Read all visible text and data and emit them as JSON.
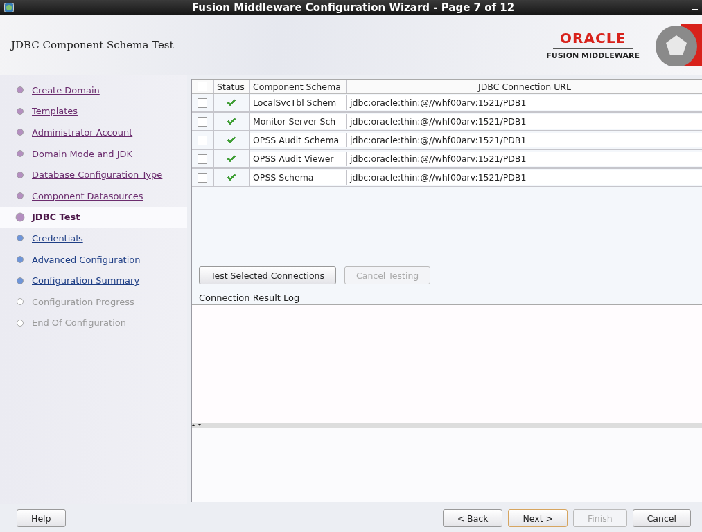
{
  "window": {
    "title": "Fusion Middleware Configuration Wizard - Page 7 of 12"
  },
  "header": {
    "title": "JDBC Component Schema Test",
    "logo": "ORACLE",
    "logo_subtitle": "FUSION MIDDLEWARE"
  },
  "steps": [
    {
      "label": "Create Domain",
      "kind": "done",
      "selected": false
    },
    {
      "label": "Templates",
      "kind": "done",
      "selected": false
    },
    {
      "label": "Administrator Account",
      "kind": "done",
      "selected": false
    },
    {
      "label": "Domain Mode and JDK",
      "kind": "done",
      "selected": false
    },
    {
      "label": "Database Configuration Type",
      "kind": "done",
      "selected": false
    },
    {
      "label": "Component Datasources",
      "kind": "done",
      "selected": false
    },
    {
      "label": "JDBC Test",
      "kind": "done",
      "selected": true
    },
    {
      "label": "Credentials",
      "kind": "next",
      "selected": false
    },
    {
      "label": "Advanced Configuration",
      "kind": "next",
      "selected": false
    },
    {
      "label": "Configuration Summary",
      "kind": "next",
      "selected": false
    },
    {
      "label": "Configuration Progress",
      "kind": "locked",
      "selected": false
    },
    {
      "label": "End Of Configuration",
      "kind": "locked",
      "selected": false
    }
  ],
  "table": {
    "all_checked": false,
    "columns": [
      "Status",
      "Component Schema",
      "JDBC Connection URL"
    ],
    "rows": [
      {
        "checked": false,
        "passed": true,
        "schema": "LocalSvcTbl Schem",
        "url": "jdbc:oracle:thin:@//whf00arv:1521/PDB1"
      },
      {
        "checked": false,
        "passed": true,
        "schema": "Monitor Server Sch",
        "url": "jdbc:oracle:thin:@//whf00arv:1521/PDB1"
      },
      {
        "checked": false,
        "passed": true,
        "schema": "OPSS Audit Schema",
        "url": "jdbc:oracle:thin:@//whf00arv:1521/PDB1"
      },
      {
        "checked": false,
        "passed": true,
        "schema": "OPSS Audit Viewer",
        "url": "jdbc:oracle:thin:@//whf00arv:1521/PDB1"
      },
      {
        "checked": false,
        "passed": true,
        "schema": "OPSS Schema",
        "url": "jdbc:oracle:thin:@//whf00arv:1521/PDB1"
      }
    ]
  },
  "actions": [
    {
      "label": "Test Selected Connections",
      "disabled": false
    },
    {
      "label": "Cancel Testing",
      "disabled": true
    }
  ],
  "log": {
    "label": "Connection Result Log"
  },
  "footer": {
    "help": "Help",
    "buttons": [
      {
        "label": "< Back",
        "disabled": false,
        "selected": false
      },
      {
        "label": "Next >",
        "disabled": false,
        "selected": true
      },
      {
        "label": "Finish",
        "disabled": true,
        "selected": false
      },
      {
        "label": "Cancel",
        "disabled": false,
        "selected": false
      }
    ]
  }
}
